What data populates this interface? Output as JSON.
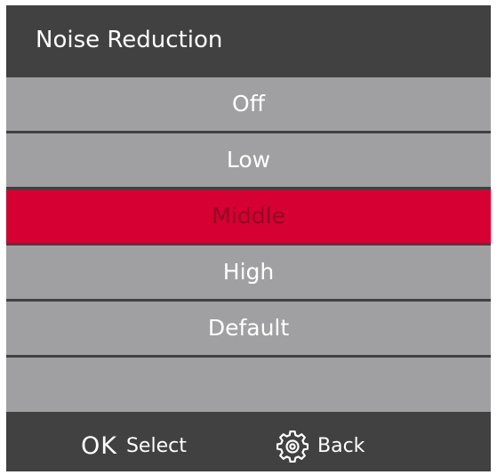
{
  "menu": {
    "title": "Noise Reduction",
    "options": [
      {
        "label": "Off",
        "selected": false
      },
      {
        "label": "Low",
        "selected": false
      },
      {
        "label": "Middle",
        "selected": true
      },
      {
        "label": "High",
        "selected": false
      },
      {
        "label": "Default",
        "selected": false
      },
      {
        "label": "",
        "selected": false
      }
    ]
  },
  "footer": {
    "ok_key": "OK",
    "select_label": "Select",
    "back_icon": "gear-icon",
    "back_label": "Back"
  },
  "colors": {
    "panel": "#414141",
    "option_bg": "#a0a0a2",
    "selected_bg": "#d60032",
    "selected_text": "#8c0022",
    "text": "#ffffff"
  }
}
